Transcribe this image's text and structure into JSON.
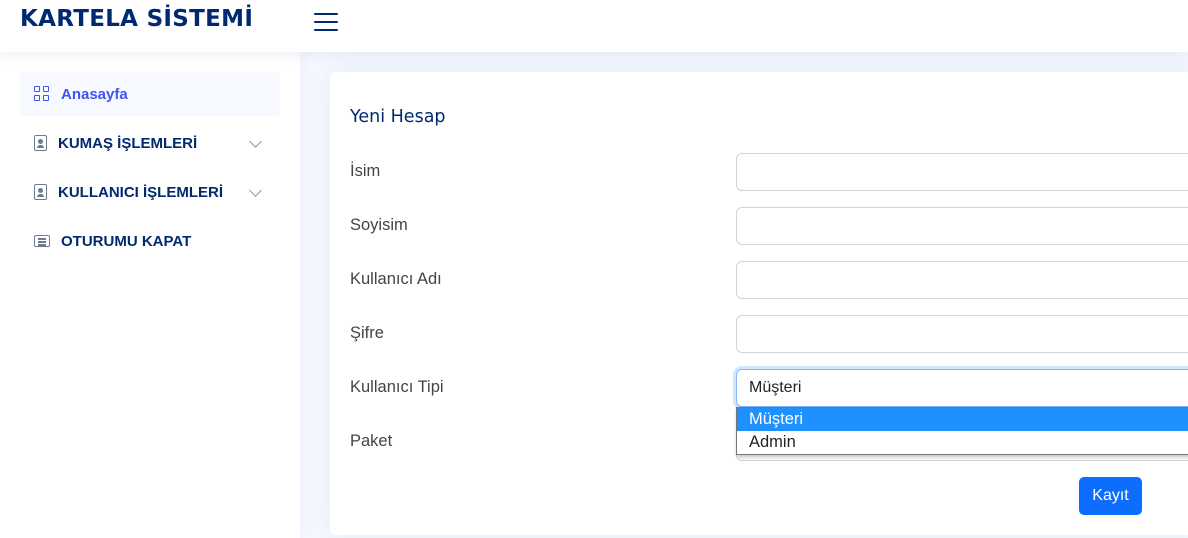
{
  "header": {
    "logo": "KARTELA SİSTEMİ",
    "menu_icon": "hamburger-menu-icon"
  },
  "sidebar": {
    "items": [
      {
        "label": "Anasayfa",
        "icon": "grid-icon",
        "active": true
      },
      {
        "label": "KUMAŞ İŞLEMLERİ",
        "icon": "person-badge-icon",
        "expandable": true
      },
      {
        "label": "KULLANICI İŞLEMLERİ",
        "icon": "person-badge-icon",
        "expandable": true
      },
      {
        "label": "OTURUMU KAPAT",
        "icon": "card-list-icon"
      }
    ]
  },
  "form": {
    "title": "Yeni Hesap",
    "fields": [
      {
        "label": "İsim",
        "value": ""
      },
      {
        "label": "Soyisim",
        "value": ""
      },
      {
        "label": "Kullanıcı Adı",
        "value": ""
      },
      {
        "label": "Şifre",
        "value": ""
      },
      {
        "label": "Kullanıcı Tipi",
        "value": "Müşteri"
      },
      {
        "label": "Paket",
        "value": ""
      }
    ],
    "user_type_options": [
      {
        "label": "Müşteri",
        "highlighted": true
      },
      {
        "label": "Admin",
        "highlighted": false
      }
    ],
    "submit_label": "Kayıt"
  },
  "colors": {
    "brand": "#012970",
    "accent": "#4154f1",
    "primary_button": "#0d6efd",
    "option_highlight": "#1e90ff"
  }
}
